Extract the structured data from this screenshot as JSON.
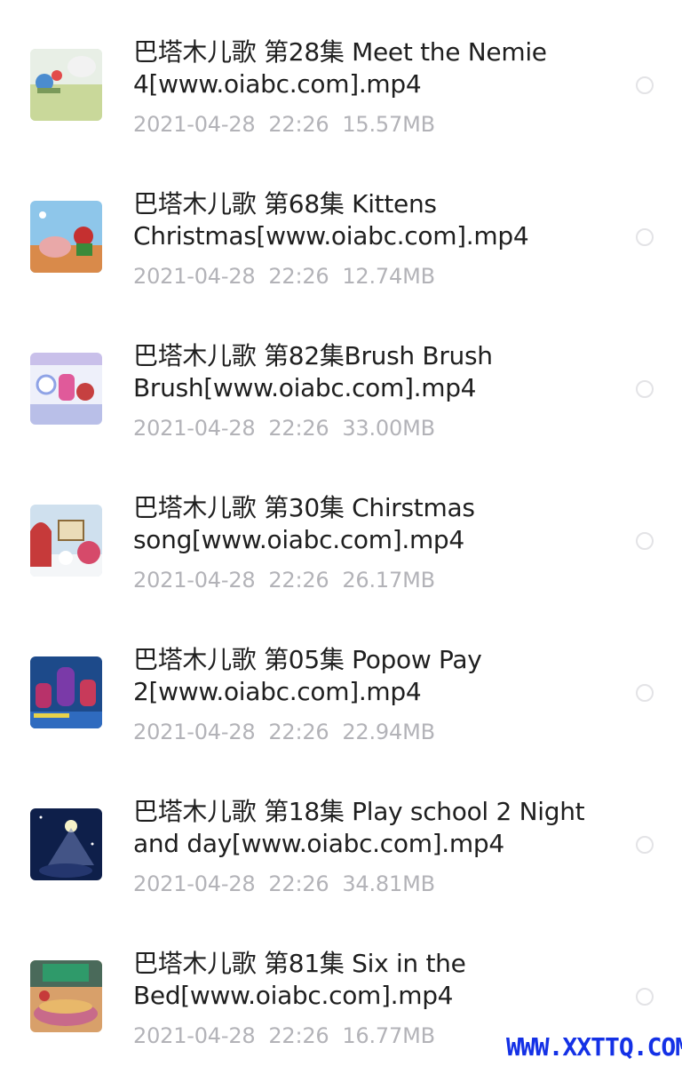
{
  "files": [
    {
      "title_line1": "巴塔木儿歌 第28集 Meet the Nemie",
      "title_line2": "4[www.oiabc.com].mp4",
      "meta": "2021-04-28  22:26  15.57MB",
      "thumbnail": "thumb-meet-the-nemie"
    },
    {
      "title_line1": "巴塔木儿歌 第68集 Kittens",
      "title_line2": "Christmas[www.oiabc.com].mp4",
      "meta": "2021-04-28  22:26  12.74MB",
      "thumbnail": "thumb-kittens-christmas"
    },
    {
      "title_line1": "巴塔木儿歌 第82集Brush Brush",
      "title_line2": "Brush[www.oiabc.com].mp4",
      "meta": "2021-04-28  22:26  33.00MB",
      "thumbnail": "thumb-brush-brush"
    },
    {
      "title_line1": "巴塔木儿歌 第30集 Chirstmas",
      "title_line2": "song[www.oiabc.com].mp4",
      "meta": "2021-04-28  22:26  26.17MB",
      "thumbnail": "thumb-christmas-song"
    },
    {
      "title_line1": "巴塔木儿歌 第05集 Popow Pay",
      "title_line2": "2[www.oiabc.com].mp4",
      "meta": "2021-04-28  22:26  22.94MB",
      "thumbnail": "thumb-popow-pay"
    },
    {
      "title_line1": "巴塔木儿歌 第18集 Play school 2 Night",
      "title_line2": "and day[www.oiabc.com].mp4",
      "meta": "2021-04-28  22:26  34.81MB",
      "thumbnail": "thumb-night-and-day"
    },
    {
      "title_line1": "巴塔木儿歌 第81集 Six in the",
      "title_line2": "Bed[www.oiabc.com].mp4",
      "meta": "2021-04-28  22:26  16.77MB",
      "thumbnail": "thumb-six-in-the-bed"
    }
  ],
  "watermark": "WWW.XXTTQ.COM",
  "colors": {
    "title": "#1f1f1f",
    "meta": "#b3b3b8",
    "radio_border": "#e3e3e6",
    "watermark": "#1431e6"
  }
}
